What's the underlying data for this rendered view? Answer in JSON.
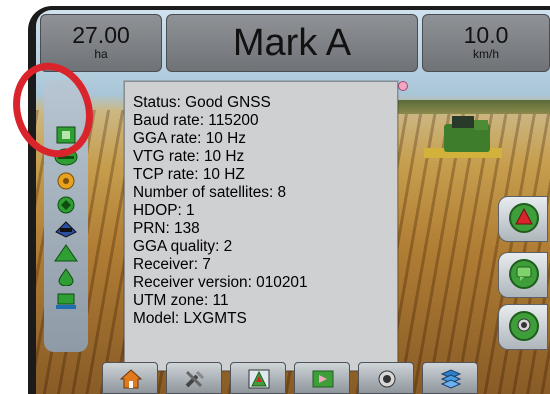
{
  "header": {
    "area_value": "27.00",
    "area_unit": "ha",
    "title": "Mark A",
    "speed_value": "10.0",
    "speed_unit": "km/h"
  },
  "gnss_info": {
    "lines": [
      "Status: Good GNSS",
      "Baud rate: 115200",
      "GGA rate: 10 Hz",
      "VTG rate: 10 Hz",
      "TCP rate: 10 HZ",
      "Number of satellites: 8",
      "HDOP: 1",
      "PRN: 138",
      "GGA quality: 2",
      "Receiver: 7",
      "Receiver version: 010201",
      "UTM zone: 11",
      "Model: LXGMTS"
    ]
  },
  "sidebar": {
    "icons": [
      "gnss-status-icon",
      "guidance-bar-icon",
      "steering-icon",
      "section-control-icon",
      "tilt-icon",
      "boundary-icon",
      "rate-icon",
      "implement-icon"
    ]
  },
  "right_buttons": [
    "guidance-view-icon",
    "chat-icon",
    "camera-icon"
  ],
  "bottom_nav": [
    "home-icon",
    "tools-icon",
    "vehicle-view-icon",
    "mark-icon",
    "camera-icon",
    "map-layers-icon"
  ],
  "colors": {
    "highlight": "#d8242a",
    "accent_green": "#3e9e3a",
    "panel_bg": "#cfd0d2"
  }
}
